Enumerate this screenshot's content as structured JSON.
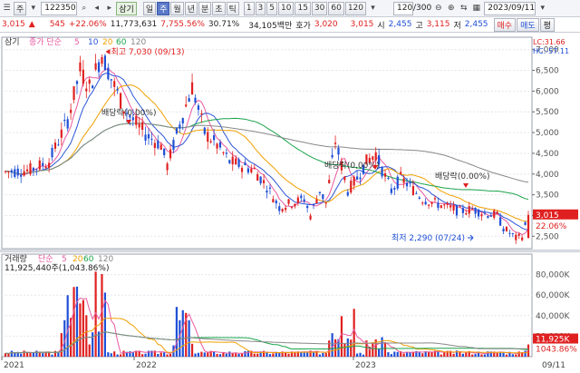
{
  "toolbar": {
    "mode": "주",
    "code": "122350",
    "stock_name": "삼기",
    "periods": [
      "일",
      "주",
      "월",
      "년",
      "분",
      "초",
      "틱"
    ],
    "active_period": "주",
    "intervals": [
      "1",
      "3",
      "5",
      "10",
      "15",
      "30",
      "60",
      "120"
    ],
    "count": "120",
    "count_total": "/300",
    "date": "2023/09/11"
  },
  "info": {
    "price": "3,015",
    "change_arrow": "▲",
    "change": "545",
    "change_pct": "+22.06%",
    "volume": "11,773,631",
    "volume_pct": "7,755.56%",
    "turnover": "30.71%",
    "amount": "34,105백만",
    "quote_label": "호가",
    "quote": "3,020",
    "quote2": "3,015",
    "open_label": "시",
    "open": "2,455",
    "high_label": "고",
    "high": "3,115",
    "low_label": "저",
    "low": "2,455",
    "buy_label": "매수",
    "sell_label": "매도",
    "flat_label": "평"
  },
  "price_panel": {
    "legend_name": "삼기",
    "legend_ma": "종가 단순",
    "ma_periods": [
      "5",
      "10",
      "20",
      "60",
      "120"
    ],
    "ma_colors": [
      "#e85aa0",
      "#2b56d6",
      "#f0a000",
      "#1aa34a",
      "#888888"
    ],
    "lc": "LC:31.66",
    "hc": "HC:-57.11",
    "y_labels": [
      "7,000",
      "6,500",
      "6,000",
      "5,500",
      "5,000",
      "4,500",
      "4,000",
      "3,500",
      "3,000",
      "2,500"
    ],
    "current_price_tag": "3,015",
    "current_pct_tag": "22.06%",
    "annotations": {
      "high": "최고 7,030 (09/13)",
      "low": "최저 2,290 (07/24)",
      "dividend1": "배당락(0.00%)",
      "dividend2": "배당락(0.00%)",
      "dividend3": "배당락(0,00%)"
    }
  },
  "volume_panel": {
    "legend_name": "거래량",
    "legend_ma": "단순",
    "ma_periods": [
      "5",
      "20",
      "60",
      "120"
    ],
    "value_label": "11,925,440주(1,043.86%)",
    "y_labels": [
      "80,000K",
      "60,000K",
      "40,000K",
      "20,000K"
    ],
    "current_tag": "11,925K",
    "current_pct_tag": "1043.86%"
  },
  "x_axis": {
    "labels": [
      "2021",
      "2022",
      "2023"
    ],
    "end_label": "09/11"
  },
  "colors": {
    "up": "#e02020",
    "down": "#1f4fd6",
    "accent": "#5a79c8"
  }
}
